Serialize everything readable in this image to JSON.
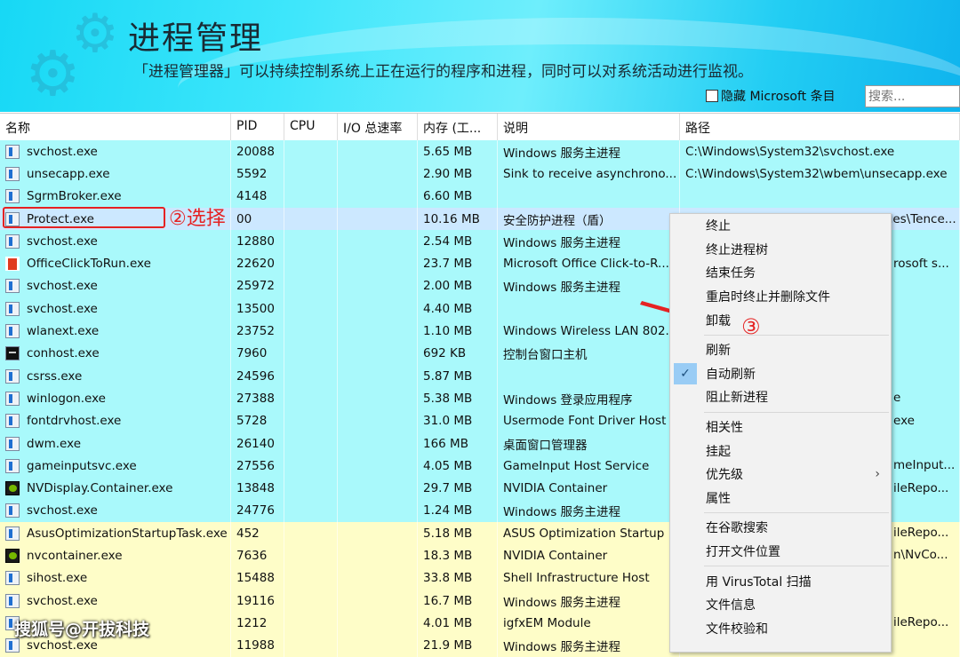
{
  "header": {
    "title": "进程管理",
    "subtitle": "「进程管理器」可以持续控制系统上正在运行的程序和进程，同时可以对系统活动进行监视。",
    "hide_ms_label": "隐藏 Microsoft 条目",
    "search_placeholder": "搜索..."
  },
  "columns": [
    "名称",
    "PID",
    "CPU",
    "I/O 总速率",
    "内存 (工...",
    "说明",
    "路径"
  ],
  "rows": [
    {
      "name": "svchost.exe",
      "pid": "20088",
      "mem": "5.65 MB",
      "desc": "Windows 服务主进程",
      "path": "C:\\Windows\\System32\\svchost.exe",
      "icon": "app",
      "color": "cyan"
    },
    {
      "name": "unsecapp.exe",
      "pid": "5592",
      "mem": "2.90 MB",
      "desc": "Sink to receive asynchrono...",
      "path": "C:\\Windows\\System32\\wbem\\unsecapp.exe",
      "icon": "app",
      "color": "cyan"
    },
    {
      "name": "SgrmBroker.exe",
      "pid": "4148",
      "mem": "6.60 MB",
      "desc": "",
      "path": "",
      "icon": "app",
      "color": "cyan"
    },
    {
      "name": "Protect.exe",
      "pid": "00",
      "mem": "10.16 MB",
      "desc": "安全防护进程（盾）",
      "path": "C:\\Program Files (x86)\\Common Files\\Tence...",
      "icon": "app",
      "color": "sel"
    },
    {
      "name": "svchost.exe",
      "pid": "12880",
      "mem": "2.54 MB",
      "desc": "Windows 服务主进程",
      "path": "",
      "icon": "app",
      "color": "cyan"
    },
    {
      "name": "OfficeClickToRun.exe",
      "pid": "22620",
      "mem": "23.7 MB",
      "desc": "Microsoft Office Click-to-R...",
      "path": "",
      "frag": "rosoft s...",
      "icon": "office",
      "color": "cyan"
    },
    {
      "name": "svchost.exe",
      "pid": "25972",
      "mem": "2.00 MB",
      "desc": "Windows 服务主进程",
      "path": "",
      "icon": "app",
      "color": "cyan"
    },
    {
      "name": "svchost.exe",
      "pid": "13500",
      "mem": "4.40 MB",
      "desc": "",
      "path": "",
      "icon": "app",
      "color": "cyan"
    },
    {
      "name": "wlanext.exe",
      "pid": "23752",
      "mem": "1.10 MB",
      "desc": "Windows Wireless LAN 802....",
      "path": "",
      "icon": "app",
      "color": "cyan"
    },
    {
      "name": "conhost.exe",
      "pid": "7960",
      "mem": "692 KB",
      "desc": "控制台窗口主机",
      "path": "",
      "icon": "console",
      "color": "cyan"
    },
    {
      "name": "csrss.exe",
      "pid": "24596",
      "mem": "5.87 MB",
      "desc": "",
      "path": "",
      "icon": "app",
      "color": "cyan"
    },
    {
      "name": "winlogon.exe",
      "pid": "27388",
      "mem": "5.38 MB",
      "desc": "Windows 登录应用程序",
      "path": "",
      "frag": "e",
      "icon": "app",
      "color": "cyan"
    },
    {
      "name": "fontdrvhost.exe",
      "pid": "5728",
      "mem": "31.0 MB",
      "desc": "Usermode Font Driver Host",
      "path": "",
      "frag": "exe",
      "icon": "app",
      "color": "cyan"
    },
    {
      "name": "dwm.exe",
      "pid": "26140",
      "mem": "166 MB",
      "desc": "桌面窗口管理器",
      "path": "",
      "icon": "app",
      "color": "cyan"
    },
    {
      "name": "gameinputsvc.exe",
      "pid": "27556",
      "mem": "4.05 MB",
      "desc": "GameInput Host Service",
      "path": "",
      "frag": "meInput...",
      "icon": "app",
      "color": "cyan"
    },
    {
      "name": "NVDisplay.Container.exe",
      "pid": "13848",
      "mem": "29.7 MB",
      "desc": "NVIDIA Container",
      "path": "",
      "frag": "ileRepo...",
      "icon": "nvidia",
      "color": "cyan"
    },
    {
      "name": "svchost.exe",
      "pid": "24776",
      "mem": "1.24 MB",
      "desc": "Windows 服务主进程",
      "path": "",
      "icon": "app",
      "color": "cyan"
    },
    {
      "name": "AsusOptimizationStartupTask.exe",
      "pid": "452",
      "mem": "5.18 MB",
      "desc": "ASUS Optimization Startup ...",
      "path": "",
      "frag": "ileRepo...",
      "icon": "app",
      "color": "yellow"
    },
    {
      "name": "nvcontainer.exe",
      "pid": "7636",
      "mem": "18.3 MB",
      "desc": "NVIDIA Container",
      "path": "",
      "frag": "n\\NvCo...",
      "icon": "nvidia",
      "color": "yellow"
    },
    {
      "name": "sihost.exe",
      "pid": "15488",
      "mem": "33.8 MB",
      "desc": "Shell Infrastructure Host",
      "path": "",
      "icon": "app",
      "color": "yellow"
    },
    {
      "name": "svchost.exe",
      "pid": "19116",
      "mem": "16.7 MB",
      "desc": "Windows 服务主进程",
      "path": "",
      "icon": "app",
      "color": "yellow"
    },
    {
      "name": "",
      "pid": "1212",
      "mem": "4.01 MB",
      "desc": "igfxEM Module",
      "path": "",
      "frag": "ileRepo...",
      "icon": "app",
      "color": "yellow"
    },
    {
      "name": "svchost.exe",
      "pid": "11988",
      "mem": "21.9 MB",
      "desc": "Windows 服务主进程",
      "path": "",
      "icon": "app",
      "color": "yellow"
    }
  ],
  "menu": [
    {
      "label": "终止"
    },
    {
      "label": "终止进程树"
    },
    {
      "label": "结束任务"
    },
    {
      "label": "重启时终止并删除文件"
    },
    {
      "label": "卸载"
    },
    {
      "sep": true
    },
    {
      "label": "刷新"
    },
    {
      "label": "自动刷新",
      "checked": true
    },
    {
      "label": "阻止新进程"
    },
    {
      "sep": true
    },
    {
      "label": "相关性"
    },
    {
      "label": "挂起"
    },
    {
      "label": "优先级",
      "submenu": true
    },
    {
      "label": "属性"
    },
    {
      "sep": true
    },
    {
      "label": "在谷歌搜索"
    },
    {
      "label": "打开文件位置"
    },
    {
      "sep": true
    },
    {
      "label": "用 VirusTotal 扫描"
    },
    {
      "label": "文件信息"
    },
    {
      "label": "文件校验和"
    }
  ],
  "annotations": {
    "step2": "②选择",
    "step3": "③"
  },
  "watermark": "搜狐号@开拔科技",
  "colors": {
    "running_service": "#a9f9fb",
    "user_process": "#fefdc8",
    "selected": "#cce8ff",
    "annotation": "#e52222"
  }
}
